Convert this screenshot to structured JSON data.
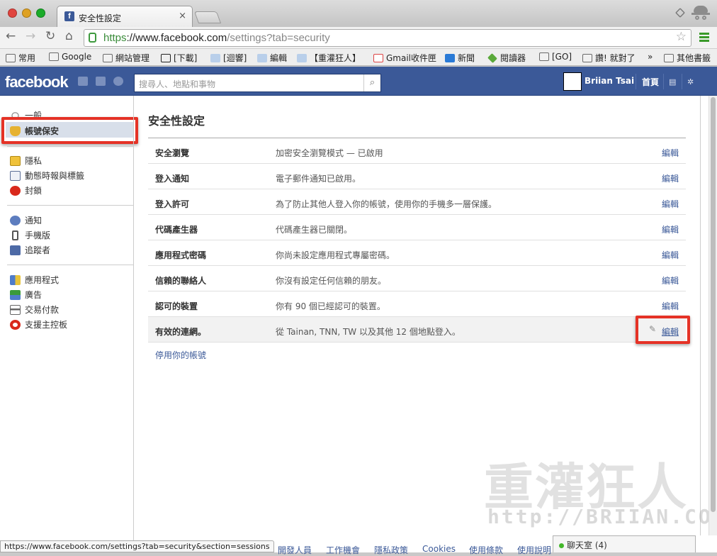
{
  "browser": {
    "tab_title": "安全性設定",
    "tab_close": "×",
    "url_scheme": "https",
    "url_host": "://www.facebook.com",
    "url_path": "/settings?tab=security",
    "bookmarks": [
      "常用",
      "Google",
      "網站管理",
      "[下載]",
      "[迴響]",
      "編輯",
      "【重灌狂人】",
      "Gmail收件匣",
      "新聞",
      "閱讀器",
      "[GO]",
      "讚! 就對了",
      "»",
      "其他書籤"
    ],
    "status_url": "https://www.facebook.com/settings?tab=security&section=sessions"
  },
  "fb": {
    "logo": "facebook",
    "search_placeholder": "搜尋人、地點和事物",
    "user_name": "Briian Tsai",
    "home_label": "首頁"
  },
  "sidebar": {
    "items": [
      {
        "label": "一般",
        "icon": "gear-icon"
      },
      {
        "label": "帳號保安",
        "icon": "shield-icon"
      },
      {
        "label": "隱私",
        "icon": "lock-icon"
      },
      {
        "label": "動態時報與標籤",
        "icon": "timeline-icon"
      },
      {
        "label": "封鎖",
        "icon": "block-icon"
      },
      {
        "label": "通知",
        "icon": "globe-icon"
      },
      {
        "label": "手機版",
        "icon": "phone-icon"
      },
      {
        "label": "追蹤者",
        "icon": "rss-icon"
      },
      {
        "label": "應用程式",
        "icon": "apps-icon"
      },
      {
        "label": "廣告",
        "icon": "ads-icon"
      },
      {
        "label": "交易付款",
        "icon": "card-icon"
      },
      {
        "label": "支援主控板",
        "icon": "lifebuoy-icon"
      }
    ]
  },
  "main": {
    "title": "安全性設定",
    "rows": [
      {
        "key": "安全瀏覽",
        "value": "加密安全瀏覽模式 — 已啟用",
        "edit": "編輯"
      },
      {
        "key": "登入通知",
        "value": "電子郵件通知已啟用。",
        "edit": "編輯"
      },
      {
        "key": "登入許可",
        "value": "為了防止其他人登入你的帳號，使用你的手機多一層保護。",
        "edit": "編輯"
      },
      {
        "key": "代碼產生器",
        "value": "代碼產生器已關閉。",
        "edit": "編輯"
      },
      {
        "key": "應用程式密碼",
        "value": "你尚未設定應用程式專屬密碼。",
        "edit": "編輯"
      },
      {
        "key": "信賴的聯絡人",
        "value": "你沒有設定任何信賴的朋友。",
        "edit": "編輯"
      },
      {
        "key": "認可的裝置",
        "value": "你有 90 個已經認可的裝置。",
        "edit": "編輯"
      },
      {
        "key": "有效的連網。",
        "value": "從 Tainan, TNN, TW 以及其他 12 個地點登入。",
        "edit": "編輯"
      }
    ],
    "deactivate": "停用你的帳號"
  },
  "footer": [
    "開發人員",
    "工作機會",
    "隱私政策",
    "Cookies",
    "使用條款",
    "使用說明"
  ],
  "chat": {
    "label": "聊天室 (4)"
  },
  "watermark": {
    "line1": "重灌狂人",
    "line2": "http://BRIIAN.COM"
  },
  "colors": {
    "fb_blue": "#3b5998",
    "highlight_red": "#e53226"
  }
}
